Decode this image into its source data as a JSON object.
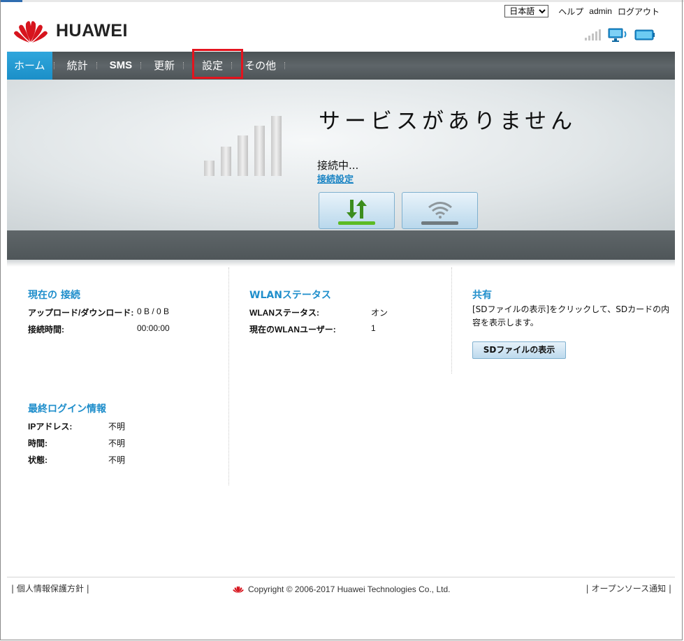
{
  "brand": {
    "name": "HUAWEI",
    "logo_icon": "huawei-petal-logo",
    "logo_color": "#d7151e"
  },
  "header": {
    "language": {
      "selected": "日本語",
      "options": [
        "日本語"
      ]
    },
    "help_label": "ヘルプ",
    "user_label": "admin",
    "logout_label": "ログアウト",
    "status_icons": [
      "signal-strength-icon",
      "pc-connected-icon",
      "battery-icon"
    ]
  },
  "nav": {
    "items": [
      {
        "label": "ホーム",
        "active": true
      },
      {
        "label": "統計",
        "active": false
      },
      {
        "label": "SMS",
        "active": false
      },
      {
        "label": "更新",
        "active": false
      },
      {
        "label": "設定",
        "active": false,
        "highlighted": true
      },
      {
        "label": "その他",
        "active": false
      }
    ],
    "active_color": "#1f9bd6",
    "highlight_color": "#e4141e"
  },
  "banner": {
    "title": "サービスがありません",
    "status": "接続中...",
    "settings_link": "接続設定",
    "buttons": [
      {
        "name": "data-connection-button",
        "icon": "updown-arrows-icon",
        "state": "on"
      },
      {
        "name": "wifi-button",
        "icon": "wifi-icon",
        "state": "off"
      }
    ]
  },
  "current_connection": {
    "title": "現在の 接続",
    "rows": [
      {
        "label": "アップロード/ダウンロード:",
        "value": "0 B / 0 B"
      },
      {
        "label": "接続時間:",
        "value": "00:00:00"
      }
    ]
  },
  "wlan_status": {
    "title": "WLANステータス",
    "rows": [
      {
        "label": "WLANステータス:",
        "value": "オン"
      },
      {
        "label": "現在のWLANユーザー:",
        "value": "1"
      }
    ]
  },
  "share": {
    "title": "共有",
    "text": "[SDファイルの表示]をクリックして、SDカードの内容を表示します。",
    "button": "SDファイルの表示"
  },
  "last_login": {
    "title": "最終ログイン情報",
    "rows": [
      {
        "label": "IPアドレス:",
        "value": "不明"
      },
      {
        "label": "時間:",
        "value": "不明"
      },
      {
        "label": "状態:",
        "value": "不明"
      }
    ]
  },
  "footer": {
    "privacy": "個人情報保護方針",
    "copyright": "Copyright © 2006-2017 Huawei Technologies Co., Ltd.",
    "open_source": "オープンソース通知"
  }
}
